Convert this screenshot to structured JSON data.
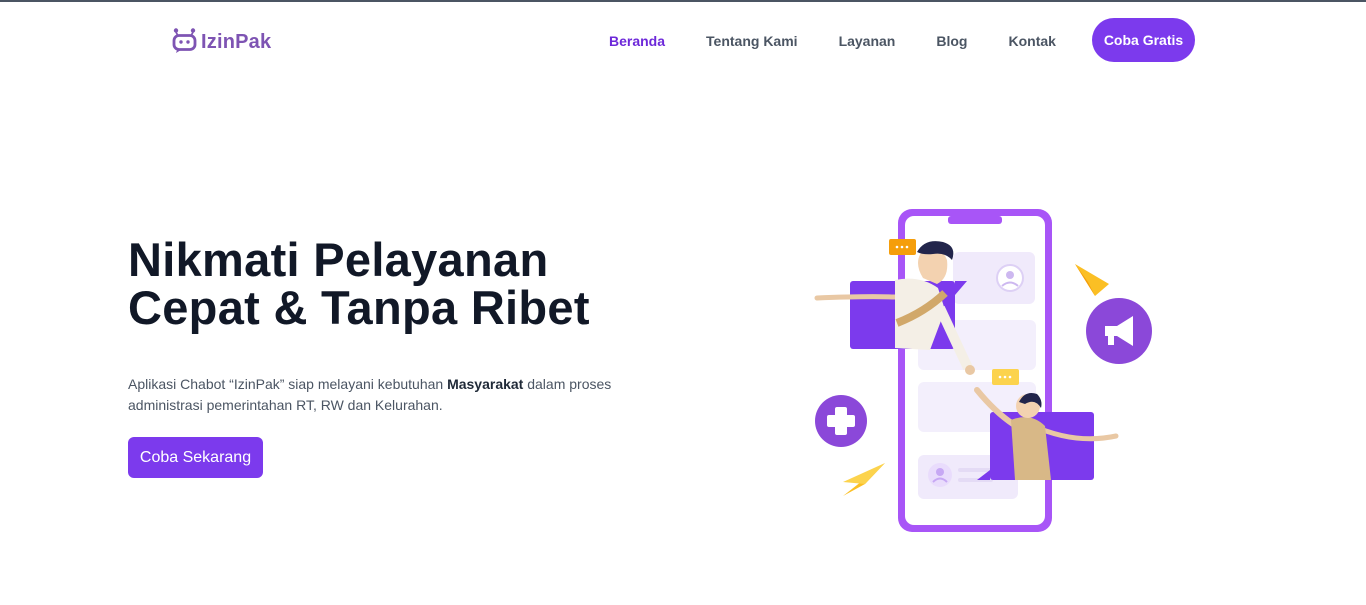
{
  "brand": {
    "name": "IzinPak",
    "logo_icon": "robot-icon",
    "color": "#7e54b3"
  },
  "nav": {
    "links": [
      {
        "label": "Beranda",
        "active": true
      },
      {
        "label": "Tentang Kami",
        "active": false
      },
      {
        "label": "Layanan",
        "active": false
      },
      {
        "label": "Blog",
        "active": false
      },
      {
        "label": "Kontak",
        "active": false
      }
    ],
    "cta_label": "Coba Gratis"
  },
  "hero": {
    "title_line1": "Nikmati Pelayanan",
    "title_line2": "Cepat & Tanpa Ribet",
    "desc_part1": "Aplikasi Chabot “IzinPak” siap melayani kebutuhan ",
    "desc_bold": "Masyarakat",
    "desc_part2": " dalam proses administrasi pemerintahan RT, RW dan Kelurahan.",
    "cta_label": "Coba Sekarang"
  },
  "colors": {
    "accent": "#7c3aed",
    "active_link": "#6d28d9",
    "text_dark": "#111827",
    "text_muted": "#4b5563"
  },
  "illustration": {
    "icons": [
      "smartphone-icon",
      "megaphone-icon",
      "plus-icon",
      "paper-plane-icon",
      "chat-bubble-icon",
      "user-avatar-icon"
    ]
  }
}
